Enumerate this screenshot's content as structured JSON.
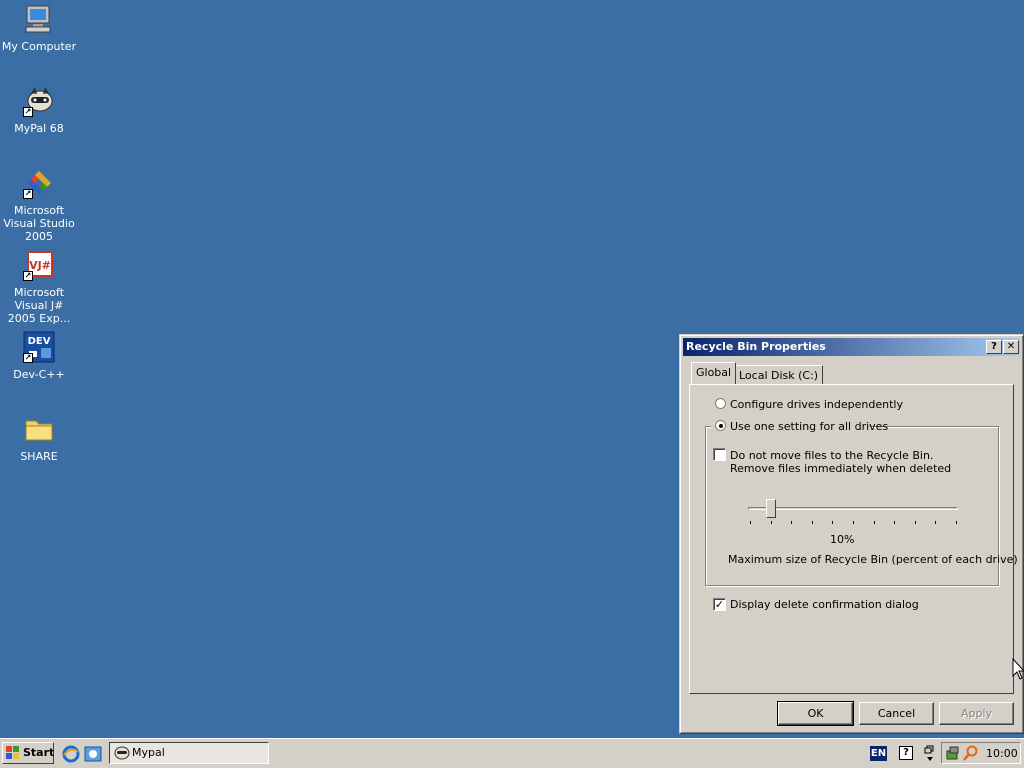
{
  "desktop": {
    "icons": [
      {
        "label": "My Computer",
        "icon": "computer-icon"
      },
      {
        "label": "MyPal 68",
        "icon": "mypal-browser-icon"
      },
      {
        "label": "Microsoft Visual Studio 2005",
        "icon": "visual-studio-icon"
      },
      {
        "label": "Microsoft Visual J# 2005 Exp...",
        "icon": "visual-jsharp-icon"
      },
      {
        "label": "Dev-C++",
        "icon": "dev-cpp-icon"
      },
      {
        "label": "SHARE",
        "icon": "folder-icon"
      }
    ]
  },
  "dialog": {
    "title": "Recycle Bin Properties",
    "help_glyph": "?",
    "close_glyph": "✕",
    "tabs": [
      {
        "label": "Global",
        "active": true
      },
      {
        "label": "Local Disk (C:)",
        "active": false
      }
    ],
    "options": {
      "configure_independently": {
        "label": "Configure drives independently",
        "selected": false
      },
      "use_one_setting": {
        "label": "Use one setting for all drives",
        "selected": true
      },
      "do_not_move_line1": "Do not move files to the Recycle Bin.",
      "do_not_move_line2": "Remove files immediately when deleted",
      "do_not_move_checked": false,
      "max_size_percent": 10,
      "max_size_display": "10%",
      "max_size_caption": "Maximum size of Recycle Bin (percent of each drive)",
      "display_confirmation_label": "Display delete confirmation dialog",
      "display_confirmation_checked": true
    },
    "buttons": {
      "ok": "OK",
      "cancel": "Cancel",
      "apply": "Apply"
    }
  },
  "taskbar": {
    "start_label": "Start",
    "task_label": "Mypal",
    "language": "EN",
    "help_glyph": "?",
    "clock": "10:00"
  },
  "colors": {
    "desktop": "#3a6ea5",
    "titlebar_start": "#0a246a",
    "titlebar_end": "#a6caf0",
    "face": "#d4d0c8"
  }
}
